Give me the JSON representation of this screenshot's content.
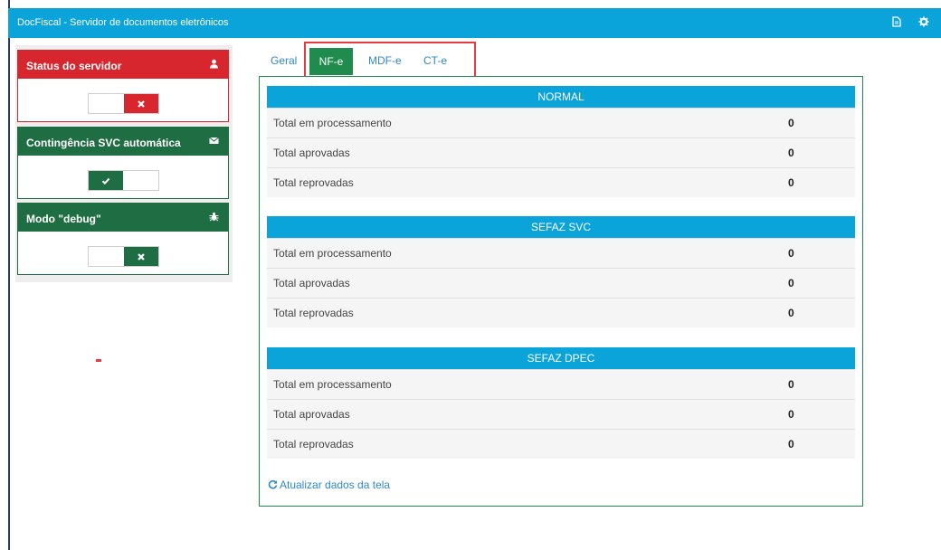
{
  "app": {
    "title": "DocFiscal - Servidor de documentos eletrônicos",
    "accent_color": "#0aa3da",
    "icons": [
      "document-icon",
      "gear-icon"
    ]
  },
  "sidebar": {
    "cards": [
      {
        "title": "Status do servidor",
        "icon": "user-icon",
        "color": "#d7262d",
        "toggle_state": "off",
        "toggle_icon": "x-icon"
      },
      {
        "title": "Contingência SVC automática",
        "icon": "envelope-icon",
        "color": "#1f6e43",
        "toggle_state": "on",
        "toggle_icon": "check-icon"
      },
      {
        "title": "Modo \"debug\"",
        "icon": "bug-icon",
        "color": "#1f6e43",
        "toggle_state": "off",
        "toggle_icon": "x-icon"
      }
    ]
  },
  "tabs": [
    {
      "label": "Geral",
      "active": false
    },
    {
      "label": "NF-e",
      "active": true
    },
    {
      "label": "MDF-e",
      "active": false
    },
    {
      "label": "CT-e",
      "active": false
    }
  ],
  "sections": [
    {
      "title": "NORMAL",
      "rows": [
        {
          "label": "Total em processamento",
          "value": "0"
        },
        {
          "label": "Total aprovadas",
          "value": "0"
        },
        {
          "label": "Total reprovadas",
          "value": "0"
        }
      ]
    },
    {
      "title": "SEFAZ SVC",
      "rows": [
        {
          "label": "Total em processamento",
          "value": "0"
        },
        {
          "label": "Total aprovadas",
          "value": "0"
        },
        {
          "label": "Total reprovadas",
          "value": "0"
        }
      ]
    },
    {
      "title": "SEFAZ DPEC",
      "rows": [
        {
          "label": "Total em processamento",
          "value": "0"
        },
        {
          "label": "Total aprovadas",
          "value": "0"
        },
        {
          "label": "Total reprovadas",
          "value": "0"
        }
      ]
    }
  ],
  "refresh_label": "Atualizar dados da tela"
}
